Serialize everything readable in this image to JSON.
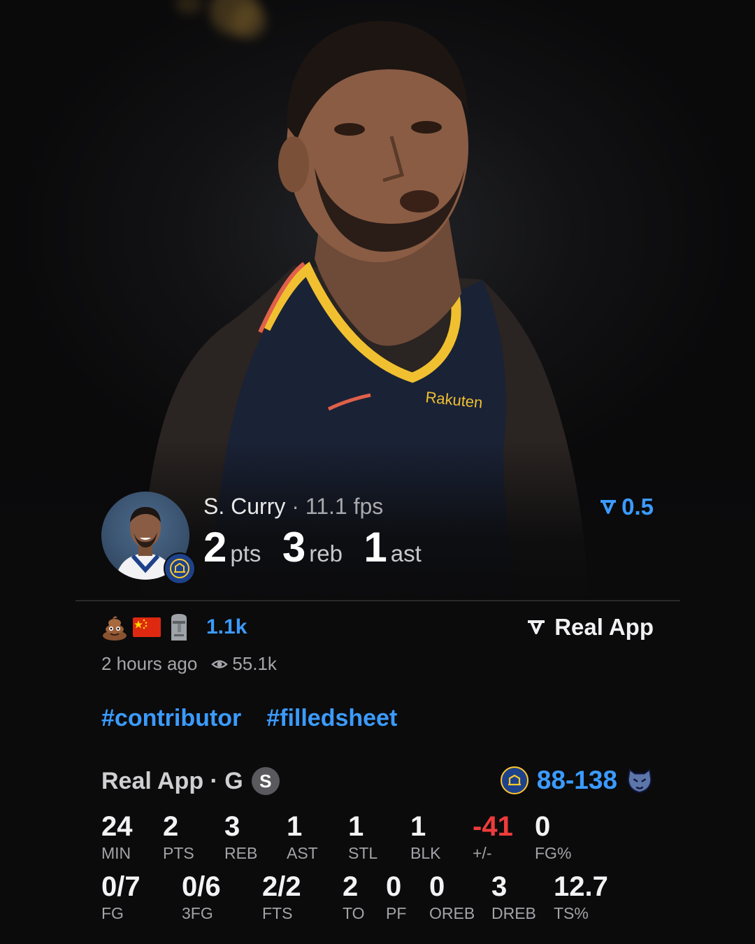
{
  "player": {
    "name": "S. Curry",
    "separator": " · ",
    "fps": "11.1 fps",
    "delta": "0.5",
    "stats": [
      {
        "value": "2",
        "unit": "pts"
      },
      {
        "value": "3",
        "unit": "reb"
      },
      {
        "value": "1",
        "unit": "ast"
      }
    ]
  },
  "reactions": {
    "icons": [
      "poop-emoji-icon",
      "china-flag-icon",
      "moai-emoji-icon"
    ],
    "count": "1.1k"
  },
  "brand": {
    "label": "Real App"
  },
  "meta": {
    "time": "2 hours ago",
    "views": "55.1k"
  },
  "tags": [
    "#contributor",
    "#filledsheet"
  ],
  "game": {
    "source": "Real App · G",
    "starter_badge": "S",
    "score_left": "88",
    "score_sep": "-",
    "score_right": "138",
    "colors": {
      "accent": "#3b9bff",
      "negative": "#ef3b3b",
      "warriors": "#1d428a",
      "grizzlies": "#5d76a9"
    }
  },
  "boxscore": {
    "row1": [
      {
        "value": "24",
        "label": "MIN"
      },
      {
        "value": "2",
        "label": "PTS"
      },
      {
        "value": "3",
        "label": "REB"
      },
      {
        "value": "1",
        "label": "AST"
      },
      {
        "value": "1",
        "label": "STL"
      },
      {
        "value": "1",
        "label": "BLK"
      },
      {
        "value": "-41",
        "label": "+/-"
      },
      {
        "value": "0",
        "label": "FG%"
      }
    ],
    "row2": [
      {
        "value": "0/7",
        "label": "FG"
      },
      {
        "value": "0/6",
        "label": "3FG"
      },
      {
        "value": "2/2",
        "label": "FTS"
      },
      {
        "value": "2",
        "label": "TO"
      },
      {
        "value": "0",
        "label": "PF"
      },
      {
        "value": "0",
        "label": "OREB"
      },
      {
        "value": "3",
        "label": "DREB"
      },
      {
        "value": "12.7",
        "label": "TS%"
      }
    ]
  }
}
